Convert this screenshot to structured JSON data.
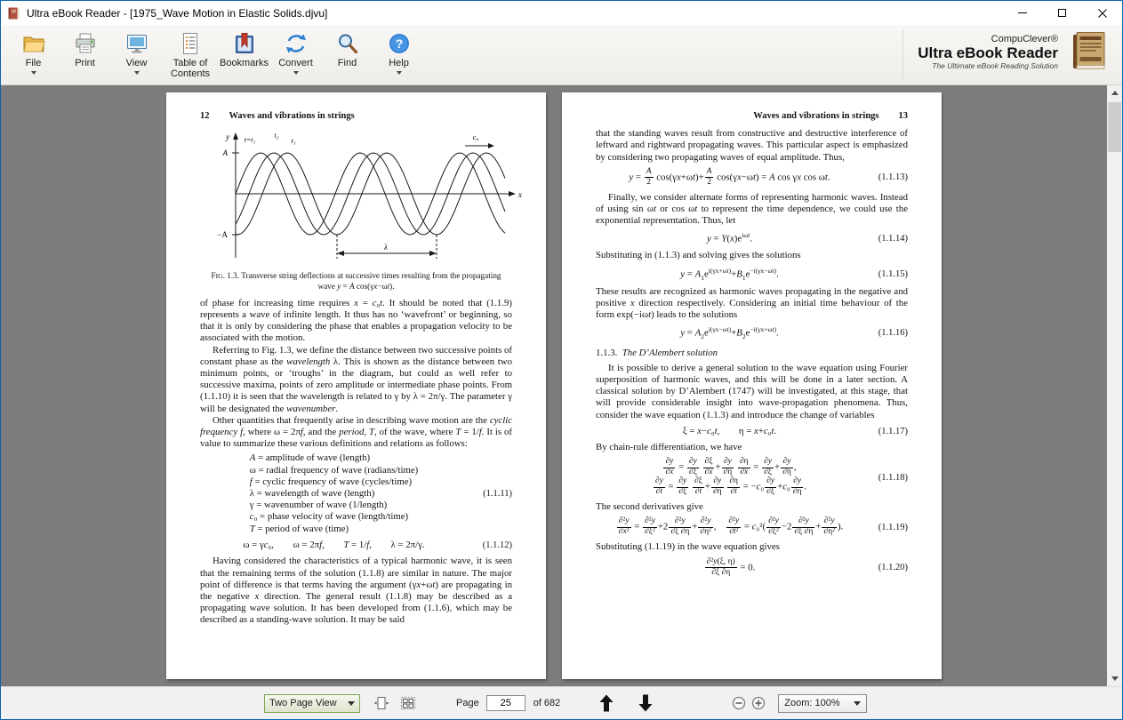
{
  "window": {
    "title": "Ultra eBook Reader - [1975_Wave Motion in Elastic Solids.djvu]"
  },
  "icons": {
    "help_glyph": "?"
  },
  "toolbar": {
    "buttons": [
      {
        "label": "File",
        "icon": "folder-open-icon",
        "dropdown": true
      },
      {
        "label": "Print",
        "icon": "printer-icon",
        "dropdown": false
      },
      {
        "label": "View",
        "icon": "monitor-icon",
        "dropdown": true
      },
      {
        "label": "Table of Contents",
        "icon": "document-list-icon",
        "dropdown": false
      },
      {
        "label": "Bookmarks",
        "icon": "bookmark-icon",
        "dropdown": false
      },
      {
        "label": "Convert",
        "icon": "convert-arrows-icon",
        "dropdown": true
      },
      {
        "label": "Find",
        "icon": "magnifier-icon",
        "dropdown": false
      },
      {
        "label": "Help",
        "icon": "question-icon",
        "dropdown": true
      }
    ],
    "branding": {
      "company": "CompuClever®",
      "product": "Ultra eBook Reader",
      "tagline": "The Ultimate eBook Reading Solution"
    }
  },
  "statusbar": {
    "view_mode": "Two Page View",
    "page_label": "Page",
    "page_value": "25",
    "page_total": "of 682",
    "zoom_label": "Zoom: 100%"
  },
  "left_page": {
    "page_number": "12",
    "running_head": "Waves and vibrations in strings",
    "figure": {
      "y_axis": "y",
      "x_axis": "x",
      "amp_pos": "A",
      "amp_neg": "−A",
      "t1": "t=t₁",
      "t2": "t₂",
      "t3": "t₃",
      "velocity": "c₀",
      "wavelength": "λ",
      "caption": "F<small>IG</small>. 1.3. Transverse string deflections at successive times resulting from the propagating wave <i>y</i> = <i>A</i> cos(γ<i>x</i>−ω<i>t</i>)."
    },
    "para1": "of phase for increasing time requires <i>x</i> = <i>c</i>₀<i>t</i>. It should be noted that (1.1.9) represents a wave of infinite length. It thus has no ‘wavefront’ or beginning, so that it is only by considering the phase that enables a propagation velocity to be associated with the motion.",
    "para2": "Referring to Fig. 1.3, we define the distance between two successive points of constant phase as the <i>wavelength</i> λ. This is shown as the distance between two minimum points, or ‘troughs’ in the diagram, but could as well refer to successive maxima, points of zero amplitude or intermediate phase points. From (1.1.10) it is seen that the wavelength is related to γ by λ = 2π/γ. The parameter γ will be designated the <i>wavenumber</i>.",
    "para3": "Other quantities that frequently arise in describing wave motion are the <i>cyclic frequency f</i>, where ω = 2π<i>f</i>, and the <i>period</i>, <i>T</i>, of the wave, where <i>T</i> = 1/<i>f</i>. It is of value to summarize these various definitions and relations as follows:",
    "definitions": [
      "<i>A</i> = amplitude of wave (length)",
      "ω = radial frequency of wave (radians/time)",
      "<i>f</i> = cyclic frequency of wave (cycles/time)",
      "λ = wavelength of wave (length)",
      "γ = wavenumber of wave (1/length)",
      "<i>c</i>₀ = phase velocity of wave (length/time)",
      "<i>T</i> = period of wave (time)"
    ],
    "eq11_number": "(1.1.11)",
    "eq12": "ω = γ<i>c</i>₀,&emsp;&emsp;ω = 2π<i>f</i>,&emsp;&emsp;<i>T</i> = 1/<i>f</i>,&emsp;&emsp;λ = 2π/γ.",
    "eq12_number": "(1.1.12)",
    "para4": "Having considered the characteristics of a typical harmonic wave, it is seen that the remaining terms of the solution (1.1.8) are similar in nature. The major point of difference is that terms having the argument (γ<i>x</i>+ω<i>t</i>) are propagating in the negative <i>x</i> direction. The general result (1.1.8) may be described as a propagating wave solution. It has been developed from (1.1.6), which may be described as a standing-wave solution. It may be said"
  },
  "right_page": {
    "page_number": "13",
    "running_head": "Waves and vibrations in strings",
    "para1": "that the standing waves result from constructive and destructive interference of leftward and rightward propagating waves. This particular aspect is emphasized by considering two propagating waves of equal amplitude. Thus,",
    "eq13": "<i>y</i> = <span class='f'><span class='n'><i>A</i></span><span class='d'>2</span></span> cos(γ<i>x</i>+ω<i>t</i>)+<span class='f'><span class='n'><i>A</i></span><span class='d'>2</span></span> cos(γ<i>x</i>−ω<i>t</i>) = <i>A</i> cos γ<i>x</i> cos ω<i>t</i>.",
    "eq13_number": "(1.1.13)",
    "para2": "Finally, we consider alternate forms of representing harmonic waves. Instead of using sin ω<i>t</i> or cos ω<i>t</i> to represent the time dependence, we could use the exponential representation. Thus, let",
    "eq14": "<i>y</i> = <i>Y</i>(<i>x</i>)e<sup>iω<i>t</i></sup>.",
    "eq14_number": "(1.1.14)",
    "para3": "Substituting in (1.1.3) and solving gives the solutions",
    "eq15": "<i>y</i> = <i>A</i><sub>1</sub>e<sup>i(γx+ωt)</sup>+<i>B</i><sub>1</sub>e<sup>−i(γx−ωt)</sup>.",
    "eq15_number": "(1.1.15)",
    "para4": "These results are recognized as harmonic waves propagating in the negative and positive <i>x</i> direction respectively. Considering an initial time behaviour of the form exp(−iω<i>t</i>) leads to the solutions",
    "eq16": "<i>y</i> = <i>A</i><sub>2</sub>e<sup>i(γx−ωt)</sup>+<i>B</i><sub>2</sub>e<sup>−i(γx+ωt)</sup>.",
    "eq16_number": "(1.1.16)",
    "section_heading": "1.1.3.&ensp;<i>The D’Alembert solution</i>",
    "para5": "It is possible to derive a general solution to the wave equation using Fourier superposition of harmonic waves, and this will be done in a later section. A classical solution by D’Alembert (1747) will be investigated, at this stage, that will provide considerable insight into wave-propagation phenomena. Thus, consider the wave equation (1.1.3) and introduce the change of variables",
    "eq17": "ξ = <i>x</i>−<i>c</i>₀<i>t</i>,&emsp;&emsp;η = <i>x</i>+<i>c</i>₀<i>t</i>.",
    "eq17_number": "(1.1.17)",
    "para6": "By chain-rule differentiation, we have",
    "eq18": "<span class='f'><span class='n'>∂<i>y</i></span><span class='d'>∂<i>x</i></span></span> = <span class='f'><span class='n'>∂<i>y</i></span><span class='d'>∂ξ</span></span> <span class='f'><span class='n'>∂ξ</span><span class='d'>∂<i>x</i></span></span>+<span class='f'><span class='n'>∂<i>y</i></span><span class='d'>∂η</span></span> <span class='f'><span class='n'>∂η</span><span class='d'>∂<i>x</i></span></span> = <span class='f'><span class='n'>∂<i>y</i></span><span class='d'>∂ξ</span></span>+<span class='f'><span class='n'>∂<i>y</i></span><span class='d'>∂η</span></span>,<br><span class='f'><span class='n'>∂<i>y</i></span><span class='d'>∂<i>t</i></span></span> = <span class='f'><span class='n'>∂<i>y</i></span><span class='d'>∂ξ</span></span> <span class='f'><span class='n'>∂ξ</span><span class='d'>∂<i>t</i></span></span>+<span class='f'><span class='n'>∂<i>y</i></span><span class='d'>∂η</span></span> <span class='f'><span class='n'>∂η</span><span class='d'>∂<i>t</i></span></span> = −<i>c</i>₀<span class='f'><span class='n'>∂<i>y</i></span><span class='d'>∂ξ</span></span>+<i>c</i>₀<span class='f'><span class='n'>∂<i>y</i></span><span class='d'>∂η</span></span>.",
    "eq18_number": "(1.1.18)",
    "para7": "The second derivatives give",
    "eq19": "<span class='f'><span class='n'>∂²<i>y</i></span><span class='d'>∂<i>x</i>²</span></span> = <span class='f'><span class='n'>∂²<i>y</i></span><span class='d'>∂ξ²</span></span>+2<span class='f'><span class='n'>∂²<i>y</i></span><span class='d'>∂ξ ∂η</span></span>+<span class='f'><span class='n'>∂²<i>y</i></span><span class='d'>∂η²</span></span>,&emsp;<span class='f'><span class='n'>∂²<i>y</i></span><span class='d'>∂<i>t</i>²</span></span> = <i>c</i>₀²(<span class='f'><span class='n'>∂²<i>y</i></span><span class='d'>∂ξ²</span></span>−2<span class='f'><span class='n'>∂²<i>y</i></span><span class='d'>∂ξ ∂η</span></span>+<span class='f'><span class='n'>∂²<i>y</i></span><span class='d'>∂η²</span></span>).",
    "eq19_number": "(1.1.19)",
    "para8": "Substituting (1.1.19) in the wave equation gives",
    "eq20": "<span class='f'><span class='n'>∂²<i>y</i>(ξ, η)</span><span class='d'>∂ξ ∂η</span></span> = 0.",
    "eq20_number": "(1.1.20)"
  }
}
